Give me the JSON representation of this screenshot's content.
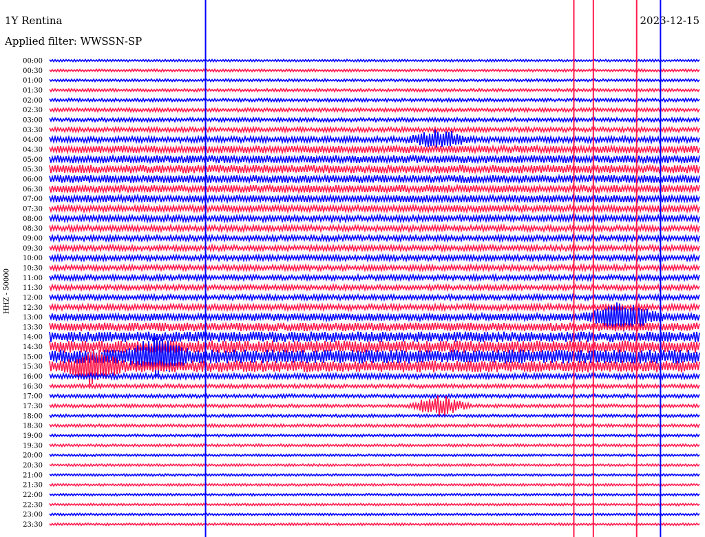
{
  "header": {
    "station": "1Y Rentina",
    "date": "2023-12-15",
    "filter": "Applied filter: WWSSN-SP"
  },
  "axis": {
    "ylabel": "HHZ - 50000"
  },
  "colors": {
    "trace_a": "#0000ff",
    "trace_b": "#ff1a4d",
    "background": "#ffffff"
  },
  "chart_data": {
    "type": "line",
    "title": "1Y Rentina",
    "subtitle": "Applied filter: WWSSN-SP",
    "ylabel": "HHZ - 50000",
    "xlabel": "",
    "y_tick_labels": [
      "00:00",
      "00:30",
      "01:00",
      "01:30",
      "02:00",
      "02:30",
      "03:00",
      "03:30",
      "04:00",
      "04:30",
      "05:00",
      "05:30",
      "06:00",
      "06:30",
      "07:00",
      "07:30",
      "08:00",
      "08:30",
      "09:00",
      "09:30",
      "10:00",
      "10:30",
      "11:00",
      "11:30",
      "12:00",
      "12:30",
      "13:00",
      "13:30",
      "14:00",
      "14:30",
      "15:00",
      "15:30",
      "16:00",
      "16:30",
      "17:00",
      "17:30",
      "18:00",
      "18:30",
      "19:00",
      "19:30",
      "20:00",
      "20:30",
      "21:00",
      "21:30",
      "22:00",
      "22:30",
      "23:00",
      "23:30"
    ],
    "series_colors": [
      "#0000ff",
      "#ff1a4d"
    ],
    "trace_minutes": 30,
    "noise_level": [
      0.35,
      0.4,
      0.4,
      0.45,
      0.5,
      0.55,
      0.6,
      0.7,
      0.9,
      1.1,
      1.2,
      1.25,
      1.2,
      1.15,
      1.1,
      1.0,
      0.95,
      0.9,
      0.85,
      0.85,
      0.85,
      0.85,
      0.8,
      0.8,
      0.8,
      0.9,
      1.1,
      1.3,
      1.6,
      1.9,
      2.2,
      1.8,
      0.8,
      0.6,
      0.55,
      0.5,
      0.45,
      0.45,
      0.4,
      0.4,
      0.35,
      0.35,
      0.35,
      0.35,
      0.35,
      0.35,
      0.35,
      0.35
    ],
    "events": [
      {
        "time": "15:00",
        "minute": 5,
        "amplitude": 3.0
      },
      {
        "time": "15:30",
        "minute": 2,
        "amplitude": 2.5
      },
      {
        "time": "04:00",
        "minute": 18,
        "amplitude": 1.6
      },
      {
        "time": "17:30",
        "minute": 18,
        "amplitude": 1.8
      },
      {
        "time": "13:00",
        "minute": 26,
        "amplitude": 1.6
      },
      {
        "time": "13:00",
        "minute": 27,
        "amplitude": 1.5
      }
    ],
    "spikes": [
      {
        "minute": 24.2,
        "color": "#ff1a4d"
      },
      {
        "minute": 25.1,
        "color": "#ff1a4d"
      },
      {
        "minute": 27.1,
        "color": "#ff1a4d"
      },
      {
        "minute": 28.2,
        "color": "#0000ff"
      },
      {
        "minute": 7.2,
        "color": "#0000ff"
      }
    ]
  }
}
